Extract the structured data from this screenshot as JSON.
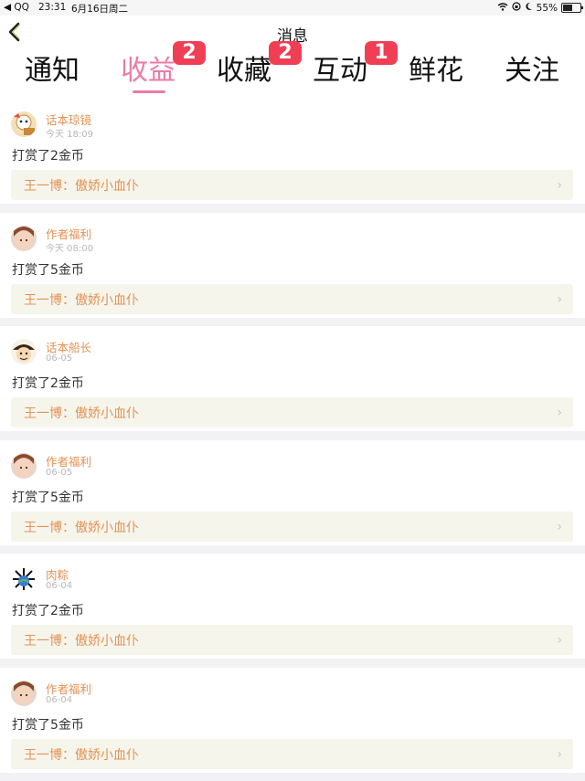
{
  "status_bar": {
    "back_app": "◀ QQ",
    "time": "23:31",
    "date": "6月16日周二",
    "battery": "55%",
    "battery_level": 0.55
  },
  "nav": {
    "title": "消息"
  },
  "tabs": [
    {
      "label": "通知",
      "badge": null,
      "active": false
    },
    {
      "label": "收益",
      "badge": "2",
      "active": true
    },
    {
      "label": "收藏",
      "badge": "2",
      "active": false
    },
    {
      "label": "互动",
      "badge": "1",
      "active": false
    },
    {
      "label": "鲜花",
      "badge": null,
      "active": false
    },
    {
      "label": "关注",
      "badge": null,
      "active": false
    }
  ],
  "colors": {
    "accent_pink": "#ee7aa6",
    "badge_red": "#f03f55",
    "name_orange": "#e39254"
  },
  "messages": [
    {
      "name": "话本琼镜",
      "time": "今天 18:09",
      "text": "打赏了2金币",
      "book": "王一博：傲娇小血仆",
      "avatar": "mascot-avatar"
    },
    {
      "name": "作者福利",
      "time": "今天 08:00",
      "text": "打赏了5金币",
      "book": "王一博：傲娇小血仆",
      "avatar": "girl-avatar"
    },
    {
      "name": "话本船长",
      "time": "06-05",
      "text": "打赏了2金币",
      "book": "王一博：傲娇小血仆",
      "avatar": "captain-avatar"
    },
    {
      "name": "作者福利",
      "time": "06-05",
      "text": "打赏了5金币",
      "book": "王一博：傲娇小血仆",
      "avatar": "girl-avatar"
    },
    {
      "name": "肉粽",
      "time": "06-04",
      "text": "打赏了2金币",
      "book": "王一博：傲娇小血仆",
      "avatar": "planet-avatar"
    },
    {
      "name": "作者福利",
      "time": "06-04",
      "text": "打赏了5金币",
      "book": "王一博：傲娇小血仆",
      "avatar": "girl-avatar"
    }
  ]
}
